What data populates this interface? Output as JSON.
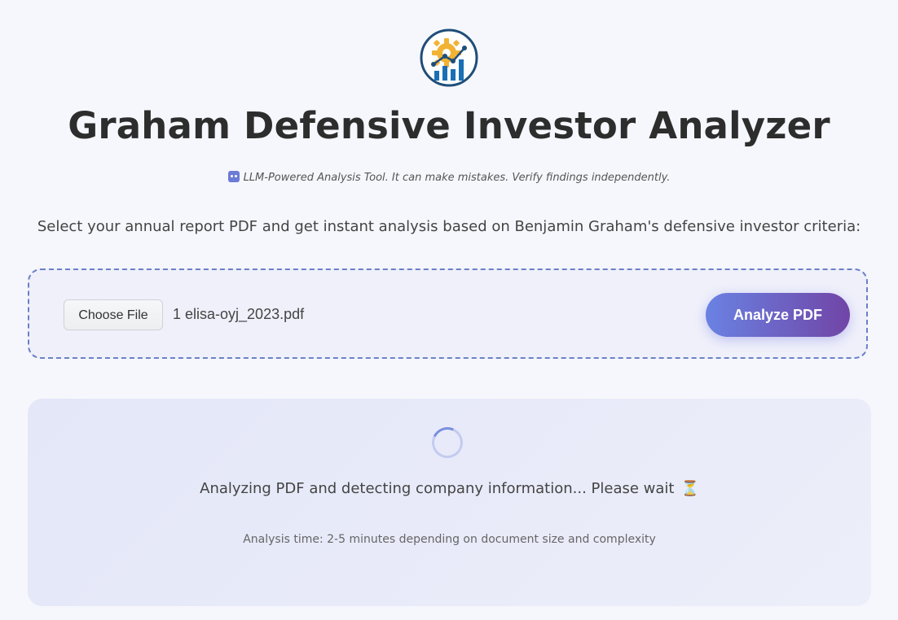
{
  "header": {
    "logo_icon": "gear-chart-logo-icon",
    "title": "Graham Defensive Investor Analyzer",
    "disclaimer_icon": "robot-icon",
    "disclaimer": "LLM-Powered Analysis Tool. It can make mistakes. Verify findings independently.",
    "intro": "Select your annual report PDF and get instant analysis based on Benjamin Graham's defensive investor criteria:"
  },
  "upload": {
    "choose_label": "Choose File",
    "file_name": "1 elisa-oyj_2023.pdf",
    "analyze_label": "Analyze PDF"
  },
  "progress": {
    "status": "Analyzing PDF and detecting company information... Please wait",
    "status_icon": "hourglass-icon",
    "status_icon_glyph": "⏳",
    "time_note": "Analysis time: 2-5 minutes depending on document size and complexity"
  },
  "colors": {
    "accent_start": "#6a82e3",
    "accent_end": "#7045a6",
    "logo_ring": "#1f4e79",
    "logo_gear": "#f2b233"
  }
}
